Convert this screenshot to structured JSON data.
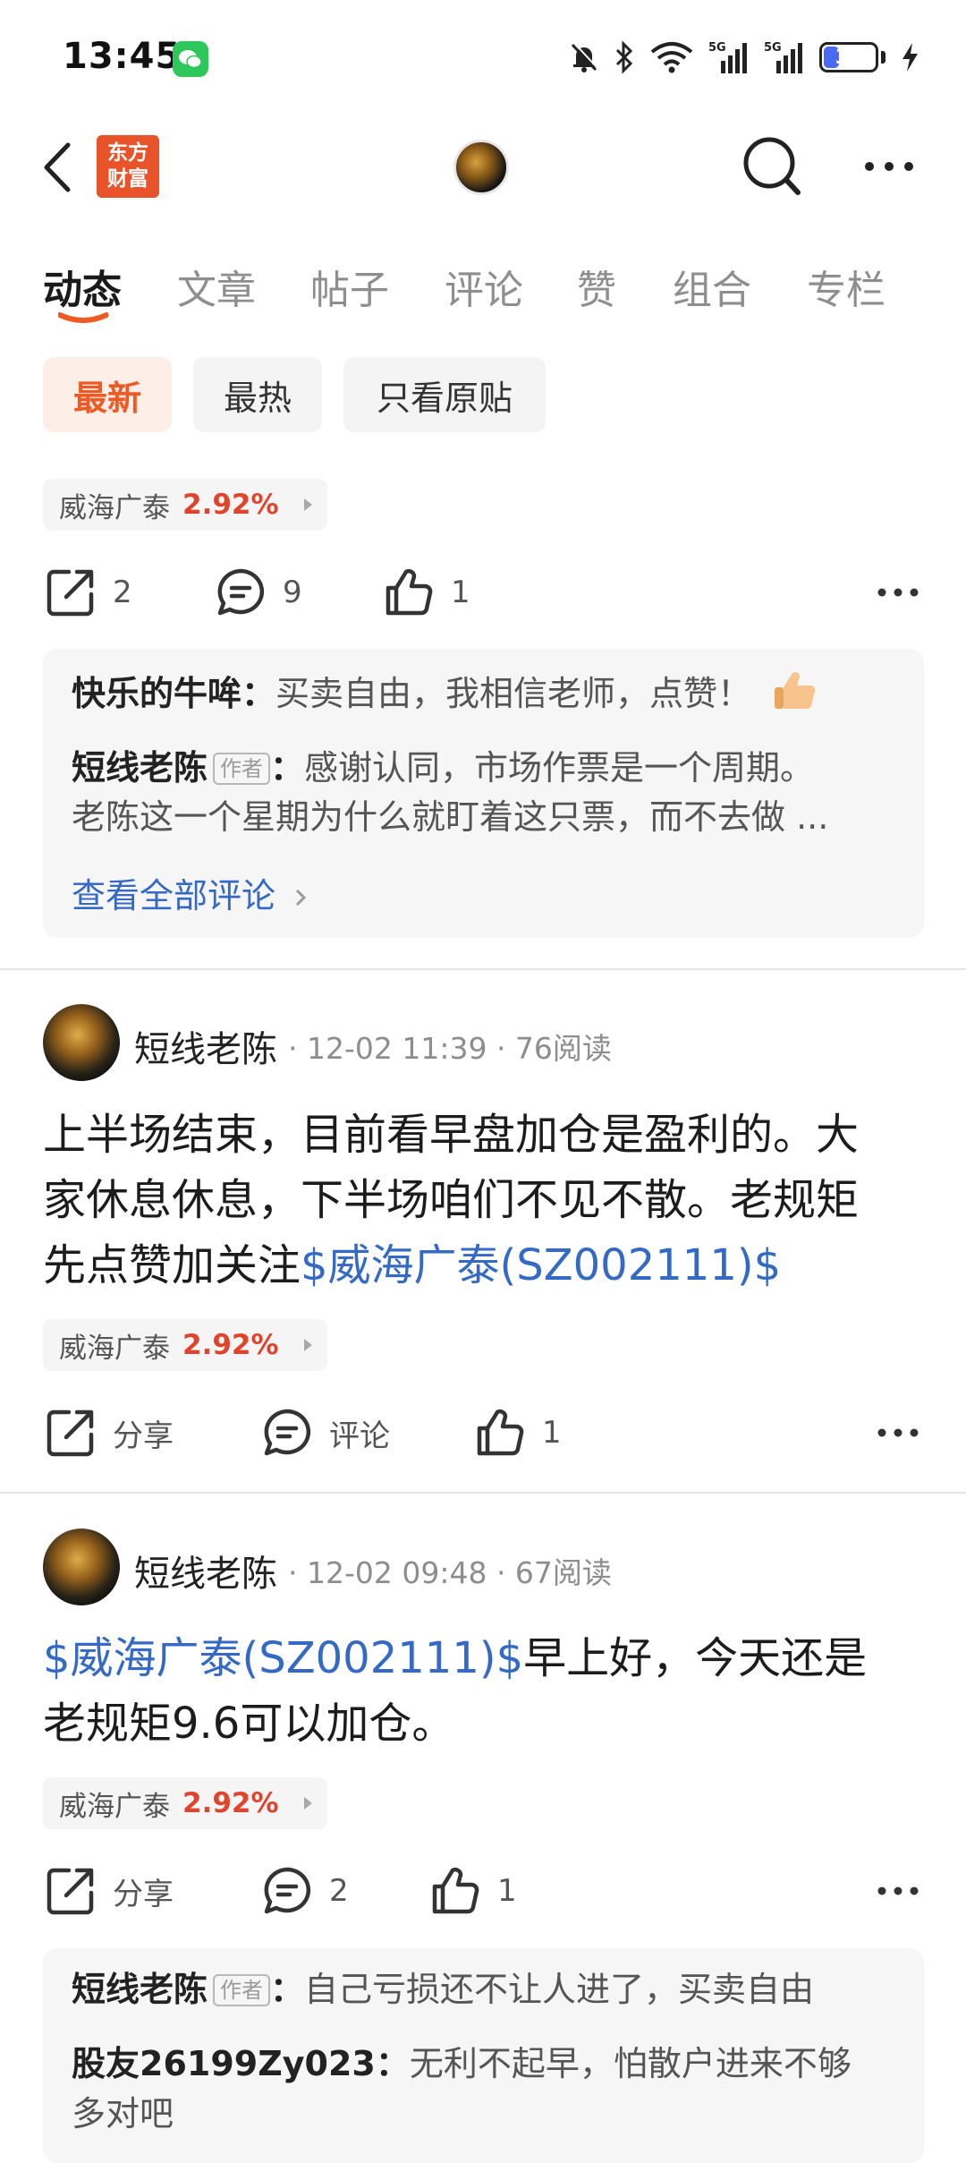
{
  "status_bar": {
    "time": "13:45",
    "battery": "31",
    "battery_level": 0.31,
    "icons": [
      "wechat-icon",
      "mute-bell-icon",
      "bluetooth-icon",
      "wifi-icon",
      "signal-5g-icon",
      "signal-5g-icon",
      "battery-icon",
      "charging-icon"
    ]
  },
  "header": {
    "logo_line1": "东方",
    "logo_line2": "财富",
    "icons": [
      "back-arrow-icon",
      "search-icon",
      "more-horizontal-icon"
    ]
  },
  "tabs": [
    {
      "label": "动态",
      "active": true
    },
    {
      "label": "文章",
      "active": false
    },
    {
      "label": "帖子",
      "active": false
    },
    {
      "label": "评论",
      "active": false
    },
    {
      "label": "赞",
      "active": false
    },
    {
      "label": "组合",
      "active": false
    },
    {
      "label": "专栏",
      "active": false
    }
  ],
  "filters": [
    {
      "label": "最新",
      "active": true
    },
    {
      "label": "最热",
      "active": false
    },
    {
      "label": "只看原贴",
      "active": false
    }
  ],
  "post0": {
    "stock_name": "威海广泰",
    "stock_pct": "2.92%",
    "share_count": "2",
    "comment_count": "9",
    "like_count": "1",
    "comments": {
      "c1_user": "快乐的牛哞：",
      "c1_text": "买卖自由，我相信老师，点赞！",
      "c2_user": "短线老陈",
      "c2_badge": "作者",
      "c2_colon": "：",
      "c2_text": "感谢认同，市场作票是一个周期。",
      "c2_text2": "老陈这一个星期为什么就盯着这只票，而不去做 ...",
      "see_all": "查看全部评论"
    }
  },
  "post1": {
    "author": "短线老陈",
    "meta": "· 12-02 11:39 · 76阅读",
    "line1": "上半场结束，目前看早盘加仓是盈利的。大",
    "line2": "家休息休息，下半场咱们不见不散。老规矩",
    "line3_text": "先点赞加关注",
    "line3_link": "$威海广泰(SZ002111)$",
    "stock_name": "威海广泰",
    "stock_pct": "2.92%",
    "share_label": "分享",
    "comment_label": "评论",
    "like_count": "1"
  },
  "post2": {
    "author": "短线老陈",
    "meta": "· 12-02 09:48 · 67阅读",
    "line1_link": "$威海广泰(SZ002111)$",
    "line1_text": "早上好，今天还是",
    "line2": "老规矩9.6可以加仓。",
    "stock_name": "威海广泰",
    "stock_pct": "2.92%",
    "share_label": "分享",
    "comment_count": "2",
    "like_count": "1",
    "comments": {
      "c1_user": "短线老陈",
      "c1_badge": "作者",
      "c1_colon": "：",
      "c1_text": "自己亏损还不让人进了，买卖自由",
      "c2_user": "股友26199Zy023：",
      "c2_text": "无利不起早，怕散户进来不够",
      "c2_text2": "多对吧"
    }
  },
  "colors": {
    "accent": "#ee5a24",
    "link": "#3469c5",
    "rise": "#e0442d",
    "logo": "#e9532a"
  }
}
